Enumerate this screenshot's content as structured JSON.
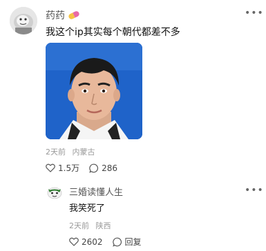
{
  "comment": {
    "username": "药药",
    "badge_icon": "pill-icon",
    "text": "我这个ip其实每个朝代都差不多",
    "time": "2天前",
    "location": "内蒙古",
    "like_count": "1.5万",
    "reply_count": "286"
  },
  "reply": {
    "username": "三婚读懂人生",
    "text": "我笑死了",
    "time": "2天前",
    "location": "陕西",
    "like_count": "2602",
    "reply_label": "回复"
  },
  "colors": {
    "photo_bg": "#1c5fc4",
    "meta_text": "#999999"
  }
}
